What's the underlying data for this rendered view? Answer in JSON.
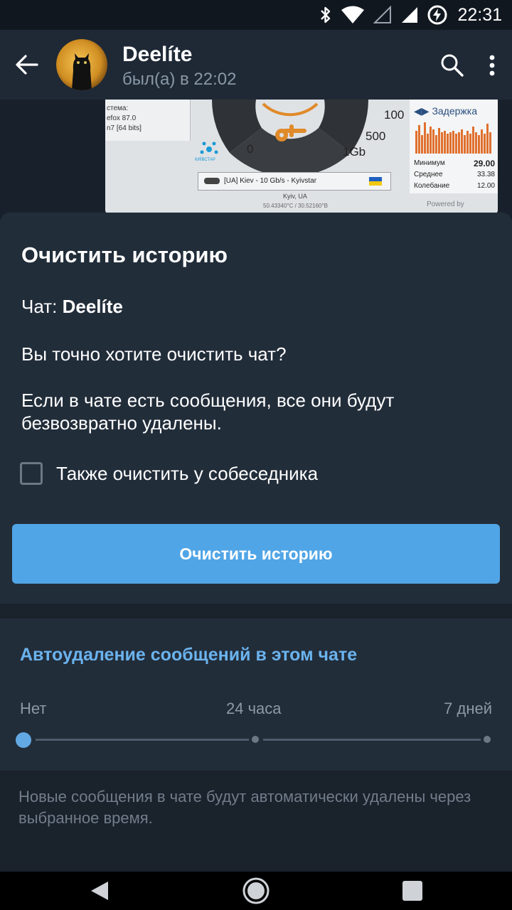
{
  "status_bar": {
    "time": "22:31",
    "icons": [
      "bluetooth-icon",
      "wifi-icon",
      "signal-empty-icon",
      "signal-full-icon",
      "battery-charging-icon"
    ]
  },
  "header": {
    "name": "Deelíte",
    "status": "был(а) в 22:02",
    "icons": [
      "back-arrow-icon",
      "search-icon",
      "more-vert-icon"
    ]
  },
  "preview": {
    "system_lines": [
      "стема:",
      "efox 87.0",
      "n7 [64 bits]"
    ],
    "gauge_labels": [
      "0",
      "1Gb",
      "500",
      "100"
    ],
    "latency_title": "Задержка",
    "stats": [
      {
        "label": "Минимум",
        "value": "29.00"
      },
      {
        "label": "Среднее",
        "value": "33.38"
      },
      {
        "label": "Колебание",
        "value": "12.00"
      }
    ],
    "server": "[UA] Kiev - 10 Gb/s - Kyivstar",
    "city": "Kyiv, UA",
    "coords": "50.43340°C / 30.52160°B",
    "powered": "Powered by",
    "isp_brand": "КИЇВСТАР"
  },
  "sheet": {
    "title": "Очистить историю",
    "chat_label": "Чат:",
    "chat_name": "Deelíte",
    "question": "Вы точно хотите очистить чат?",
    "warning": "Если в чате есть сообщения, все они будут безвозвратно удалены.",
    "checkbox_label": "Также очистить у собеседника",
    "checkbox_checked": false,
    "button_label": "Очистить историю",
    "button_color": "#50a5e6"
  },
  "auto_delete": {
    "title": "Автоудаление сообщений в этом чате",
    "options": [
      "Нет",
      "24 часа",
      "7 дней"
    ],
    "selected": "Нет",
    "accent_color": "#6bb3ee",
    "note": "Новые сообщения в чате будут автоматически удалены через выбранное время."
  },
  "nav_bar": {
    "icons": [
      "nav-back-icon",
      "nav-home-icon",
      "nav-recents-icon"
    ]
  }
}
